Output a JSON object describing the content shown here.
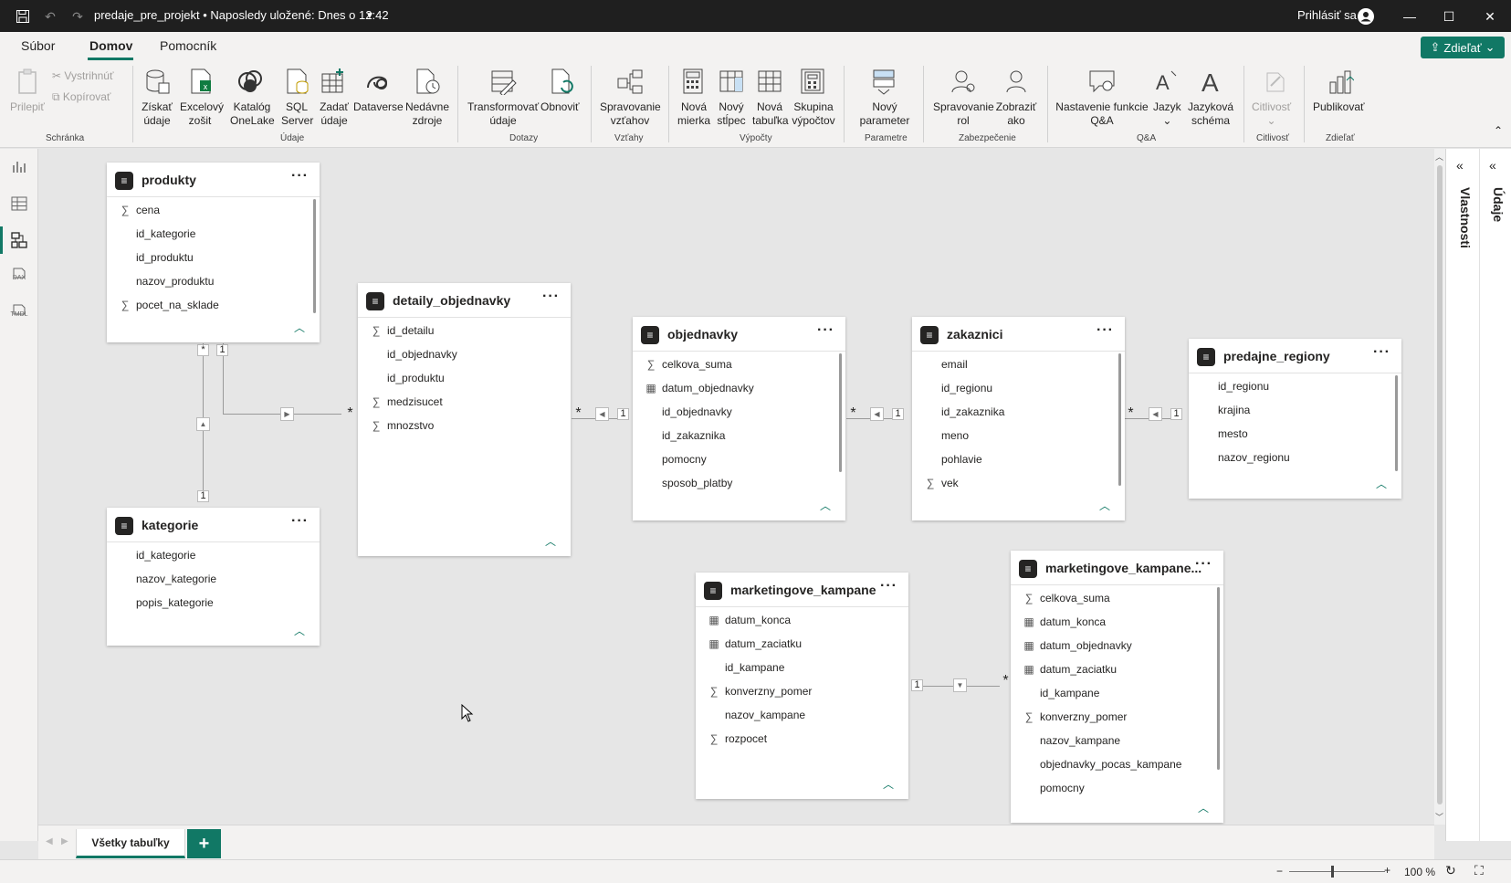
{
  "titlebar": {
    "title": "predaje_pre_projekt • Naposledy uložené: Dnes o 12:42",
    "signin": "Prihlásiť sa"
  },
  "menu": {
    "items": [
      "Súbor",
      "Domov",
      "Pomocník"
    ],
    "active": "Domov",
    "share": "Zdieľať"
  },
  "ribbon": {
    "paste": "Prilepiť",
    "cut": "Vystrihnúť",
    "copy": "Kopírovať",
    "get_data": "Získať údaje",
    "excel": "Excelový zošit",
    "onelake": "Katalóg OneLake",
    "sql": "SQL Server",
    "enter_data": "Zadať údaje",
    "dataverse": "Dataverse",
    "recent": "Nedávne zdroje",
    "transform": "Transformovať údaje",
    "refresh": "Obnoviť",
    "manage_rel": "Spravovanie vzťahov",
    "new_measure": "Nová mierka",
    "new_column": "Nový stĺpec",
    "new_table": "Nová tabuľka",
    "calc_group": "Skupina výpočtov",
    "new_param": "Nový parameter",
    "manage_roles": "Spravovanie rol",
    "view_as": "Zobraziť ako",
    "qa_setup": "Nastavenie funkcie Q&A",
    "language": "Jazyk",
    "ling_schema": "Jazyková schéma",
    "sensitivity": "Citlivosť",
    "publish": "Publikovať",
    "groups": {
      "clipboard": "Schránka",
      "data": "Údaje",
      "queries": "Dotazy",
      "relationships": "Vzťahy",
      "calculations": "Výpočty",
      "parameters": "Parametre",
      "security": "Zabezpečenie",
      "qa": "Q&A",
      "sensitivity": "Citlivosť",
      "share": "Zdieľať"
    }
  },
  "leftnav": {
    "dax": "DAX",
    "tmdl": "TMDL"
  },
  "panels": {
    "properties": "Vlastnosti",
    "data": "Údaje"
  },
  "tables": {
    "produkty": {
      "name": "produkty",
      "fields": [
        [
          "∑",
          "cena"
        ],
        [
          "",
          "id_kategorie"
        ],
        [
          "",
          "id_produktu"
        ],
        [
          "",
          "nazov_produktu"
        ],
        [
          "∑",
          "pocet_na_sklade"
        ]
      ]
    },
    "kategorie": {
      "name": "kategorie",
      "fields": [
        [
          "",
          "id_kategorie"
        ],
        [
          "",
          "nazov_kategorie"
        ],
        [
          "",
          "popis_kategorie"
        ]
      ]
    },
    "detaily": {
      "name": "detaily_objednavky",
      "fields": [
        [
          "∑",
          "id_detailu"
        ],
        [
          "",
          "id_objednavky"
        ],
        [
          "",
          "id_produktu"
        ],
        [
          "∑",
          "medzisucet"
        ],
        [
          "∑",
          "mnozstvo"
        ]
      ]
    },
    "objednavky": {
      "name": "objednavky",
      "fields": [
        [
          "∑",
          "celkova_suma"
        ],
        [
          "▦",
          "datum_objednavky"
        ],
        [
          "",
          "id_objednavky"
        ],
        [
          "",
          "id_zakaznika"
        ],
        [
          "",
          "pomocny"
        ],
        [
          "",
          "sposob_platby"
        ]
      ]
    },
    "zakaznici": {
      "name": "zakaznici",
      "fields": [
        [
          "",
          "email"
        ],
        [
          "",
          "id_regionu"
        ],
        [
          "",
          "id_zakaznika"
        ],
        [
          "",
          "meno"
        ],
        [
          "",
          "pohlavie"
        ],
        [
          "∑",
          "vek"
        ]
      ]
    },
    "regiony": {
      "name": "predajne_regiony",
      "fields": [
        [
          "",
          "id_regionu"
        ],
        [
          "",
          "krajina"
        ],
        [
          "",
          "mesto"
        ],
        [
          "",
          "nazov_regionu"
        ]
      ]
    },
    "kampane": {
      "name": "marketingove_kampane",
      "fields": [
        [
          "▦",
          "datum_konca"
        ],
        [
          "▦",
          "datum_zaciatku"
        ],
        [
          "",
          "id_kampane"
        ],
        [
          "∑",
          "konverzny_pomer"
        ],
        [
          "",
          "nazov_kampane"
        ],
        [
          "∑",
          "rozpocet"
        ]
      ]
    },
    "kampane2": {
      "name": "marketingove_kampane...",
      "fields": [
        [
          "∑",
          "celkova_suma"
        ],
        [
          "▦",
          "datum_konca"
        ],
        [
          "▦",
          "datum_objednavky"
        ],
        [
          "▦",
          "datum_zaciatku"
        ],
        [
          "",
          "id_kampane"
        ],
        [
          "∑",
          "konverzny_pomer"
        ],
        [
          "",
          "nazov_kampane"
        ],
        [
          "",
          "objednavky_pocas_kampane"
        ],
        [
          "",
          "pomocny"
        ]
      ]
    }
  },
  "rel": {
    "one": "1",
    "many": "*"
  },
  "tabs": {
    "all_tables": "Všetky tabuľky",
    "add": "+"
  },
  "status": {
    "zoom": "100 %"
  }
}
